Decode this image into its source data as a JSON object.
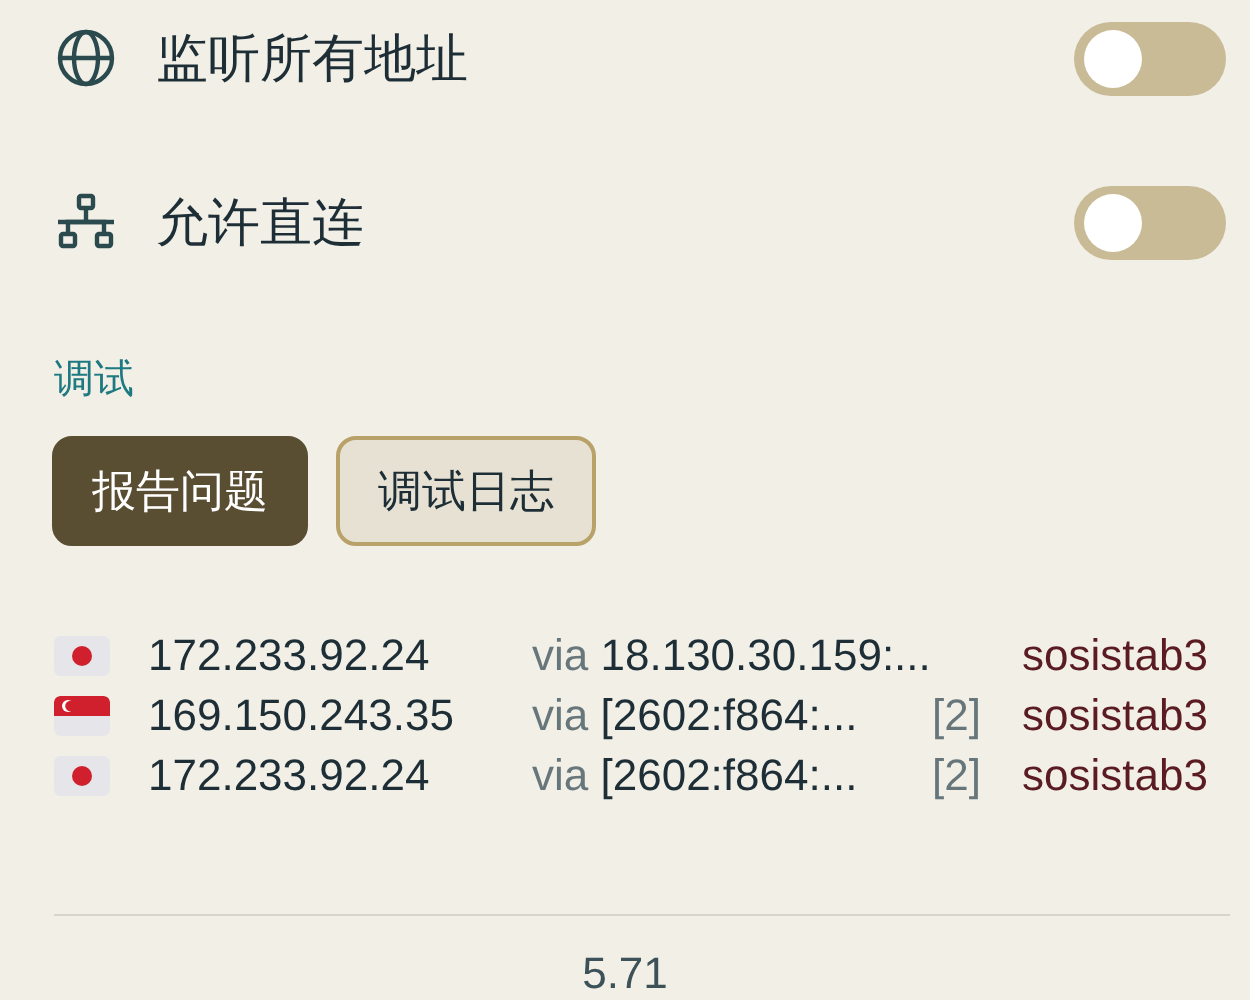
{
  "settings": [
    {
      "kind": "globe",
      "label": "监听所有地址",
      "on": false
    },
    {
      "kind": "network",
      "label": "允许直连",
      "on": false
    }
  ],
  "debug_section": {
    "title": "调试",
    "buttons": [
      {
        "label": "报告问题",
        "kind": "primary"
      },
      {
        "label": "调试日志",
        "kind": "secondary"
      }
    ]
  },
  "connections": [
    {
      "kind": "jp",
      "address": "172.233.92.24",
      "via_label": "via",
      "via": "18.130.30.159:...",
      "protocol": "sosistab3"
    },
    {
      "kind": "sg",
      "address": "169.150.243.35",
      "via_label": "via",
      "via": "[2602:f864:...",
      "count": "[2]",
      "protocol": "sosistab3"
    },
    {
      "kind": "jp",
      "address": "172.233.92.24",
      "via_label": "via",
      "via": "[2602:f864:...",
      "count": "[2]",
      "protocol": "sosistab3"
    }
  ],
  "version": "5.71"
}
